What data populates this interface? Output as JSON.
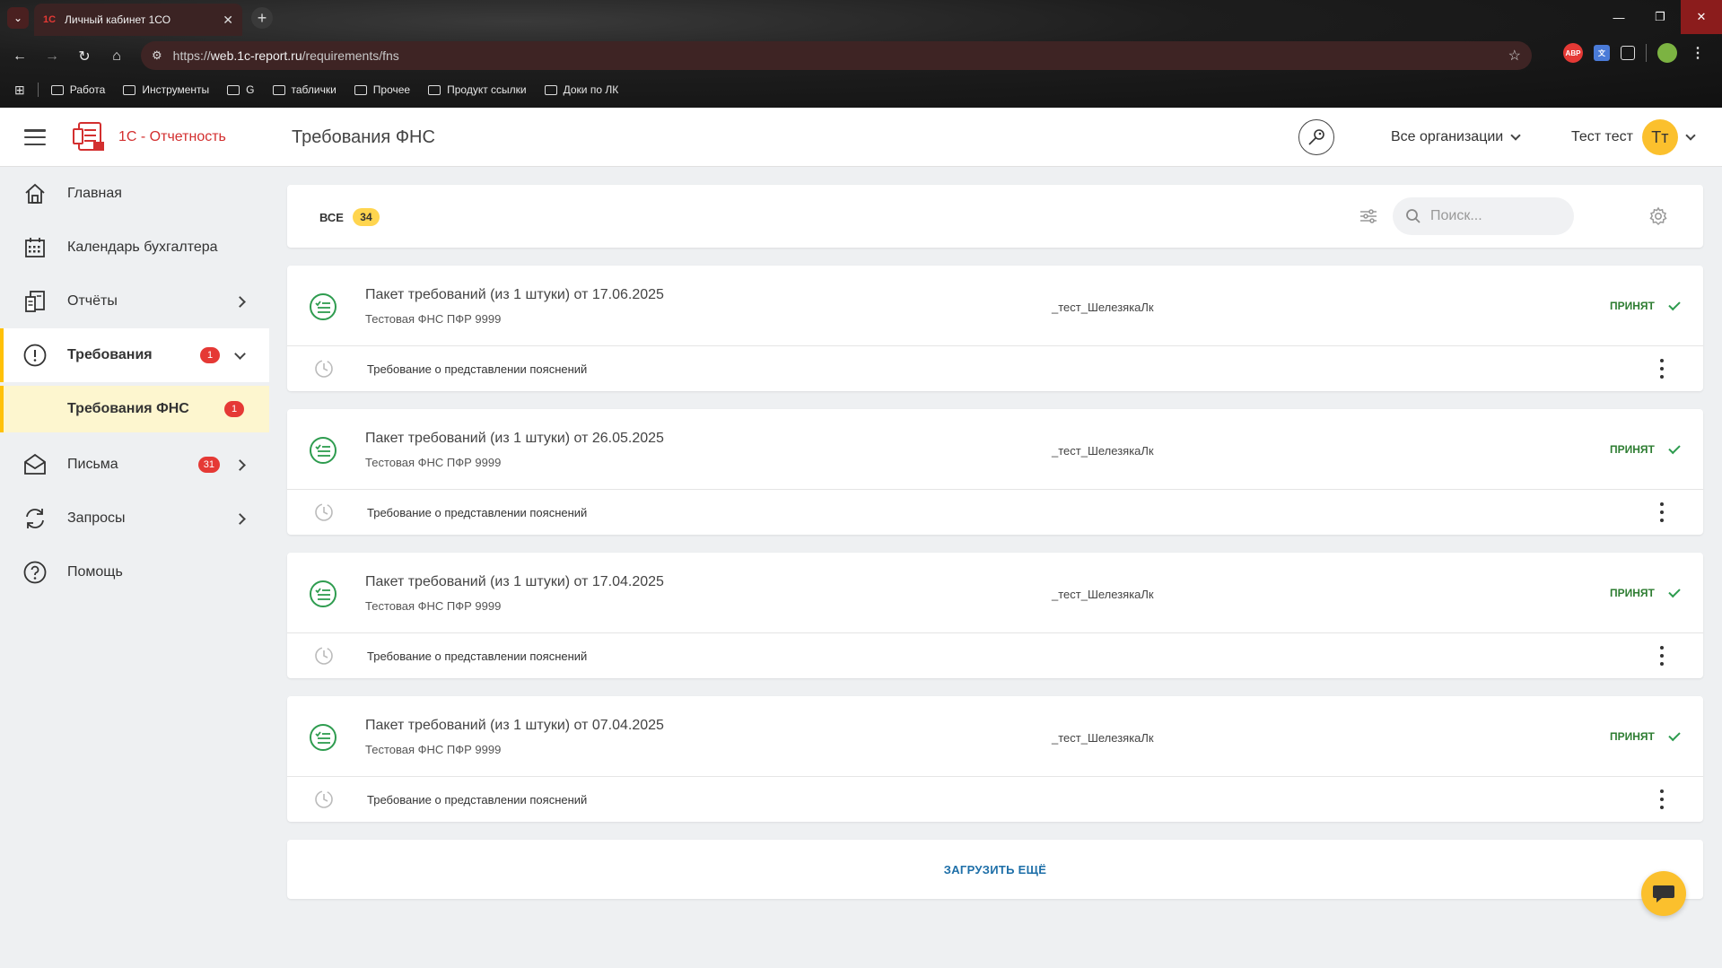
{
  "browser": {
    "tab_title": "Личный кабинет 1СО",
    "tab_favicon": "1С",
    "url_scheme": "https://",
    "url_host": "web.1c-report.ru",
    "url_path": "/requirements/fns",
    "bookmarks": [
      "Работа",
      "Инструменты",
      "G",
      "таблички",
      "Прочее",
      "Продукт ссылки",
      "Доки по ЛК"
    ]
  },
  "header": {
    "logo_text": "1С - Отчетность",
    "page_title": "Требования ФНС",
    "org_selector": "Все организации",
    "user_name": "Тест тест",
    "user_initials": "Тт"
  },
  "sidebar": {
    "items": [
      {
        "label": "Главная",
        "icon": "home-icon"
      },
      {
        "label": "Календарь бухгалтера",
        "icon": "calendar-icon"
      },
      {
        "label": "Отчёты",
        "icon": "reports-icon"
      },
      {
        "label": "Требования",
        "icon": "alert-circle-icon",
        "badge": "1"
      },
      {
        "label": "Требования ФНС",
        "badge": "1"
      },
      {
        "label": "Письма",
        "icon": "mail-icon",
        "badge": "31"
      },
      {
        "label": "Запросы",
        "icon": "sync-icon"
      },
      {
        "label": "Помощь",
        "icon": "help-icon"
      }
    ]
  },
  "filter": {
    "tab_all_label": "ВСЕ",
    "tab_all_count": "34",
    "search_placeholder": "Поиск..."
  },
  "requirements": [
    {
      "title": "Пакет требований (из 1 штуки) от 17.06.2025",
      "subtitle": "Тестовая ФНС ПФР  9999",
      "organization": "_тест_ШелезякаЛк",
      "status": "ПРИНЯТ",
      "document": "Требование о представлении пояснений"
    },
    {
      "title": "Пакет требований (из 1 штуки) от 26.05.2025",
      "subtitle": "Тестовая ФНС ПФР  9999",
      "organization": "_тест_ШелезякаЛк",
      "status": "ПРИНЯТ",
      "document": "Требование о представлении пояснений"
    },
    {
      "title": "Пакет требований (из 1 штуки) от 17.04.2025",
      "subtitle": "Тестовая ФНС ПФР  9999",
      "organization": "_тест_ШелезякаЛк",
      "status": "ПРИНЯТ",
      "document": "Требование о представлении пояснений"
    },
    {
      "title": "Пакет требований (из 1 штуки) от 07.04.2025",
      "subtitle": "Тестовая ФНС ПФР  9999",
      "organization": "_тест_ШелезякаЛк",
      "status": "ПРИНЯТ",
      "document": "Требование о представлении пояснений"
    }
  ],
  "load_more_label": "ЗАГРУЗИТЬ ЕЩЁ",
  "colors": {
    "brand_red": "#d32f2f",
    "accent_yellow": "#ffc107",
    "status_green": "#2e7d32",
    "link_blue": "#1e6fa8"
  }
}
